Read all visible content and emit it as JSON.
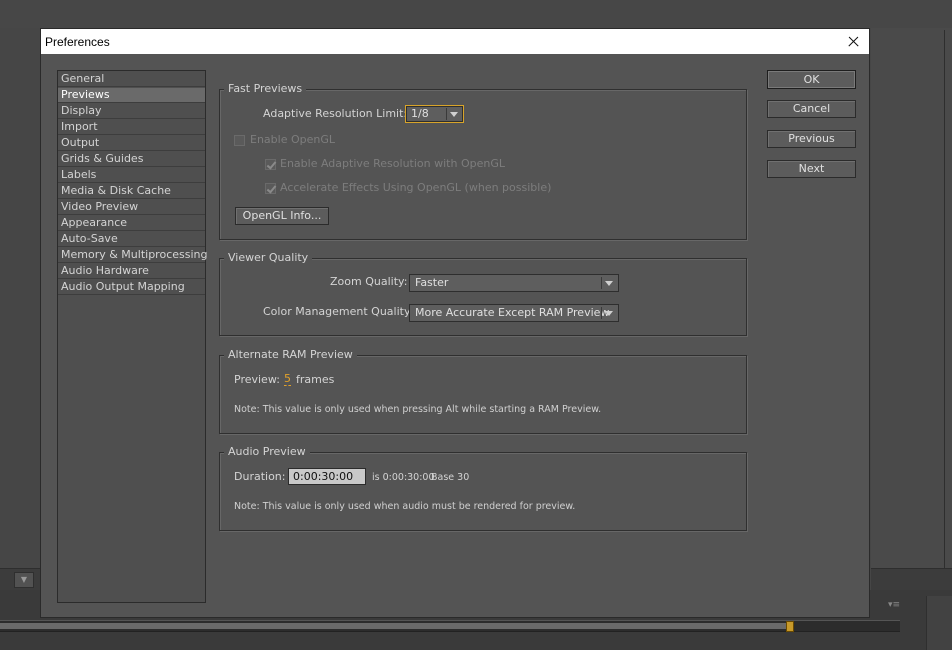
{
  "dialog": {
    "title": "Preferences"
  },
  "categories": [
    {
      "label": "General",
      "selected": false
    },
    {
      "label": "Previews",
      "selected": true
    },
    {
      "label": "Display",
      "selected": false
    },
    {
      "label": "Import",
      "selected": false
    },
    {
      "label": "Output",
      "selected": false
    },
    {
      "label": "Grids & Guides",
      "selected": false
    },
    {
      "label": "Labels",
      "selected": false
    },
    {
      "label": "Media & Disk Cache",
      "selected": false
    },
    {
      "label": "Video Preview",
      "selected": false
    },
    {
      "label": "Appearance",
      "selected": false
    },
    {
      "label": "Auto-Save",
      "selected": false
    },
    {
      "label": "Memory & Multiprocessing",
      "selected": false
    },
    {
      "label": "Audio Hardware",
      "selected": false
    },
    {
      "label": "Audio Output Mapping",
      "selected": false
    }
  ],
  "fast_previews": {
    "title": "Fast Previews",
    "adaptive_label": "Adaptive Resolution Limit:",
    "adaptive_value": "1/8",
    "enable_opengl_label": "Enable OpenGL",
    "enable_opengl_checked": false,
    "adaptive_opengl_label": "Enable Adaptive Resolution with OpenGL",
    "adaptive_opengl_checked": true,
    "accelerate_label": "Accelerate Effects Using OpenGL (when possible)",
    "accelerate_checked": true,
    "opengl_info_button": "OpenGL Info..."
  },
  "viewer_quality": {
    "title": "Viewer Quality",
    "zoom_label": "Zoom Quality:",
    "zoom_value": "Faster",
    "color_label": "Color Management Quality:",
    "color_value": "More Accurate Except RAM Preview"
  },
  "ram_preview": {
    "title": "Alternate RAM Preview",
    "preview_label": "Preview:",
    "preview_value": "5",
    "preview_unit": "frames",
    "note": "Note: This value is only used when pressing Alt while starting a RAM Preview."
  },
  "audio_preview": {
    "title": "Audio Preview",
    "duration_label": "Duration:",
    "duration_value": "0:00:30:00",
    "duration_info": "is 0:00:30:00",
    "base_info": "Base 30",
    "note": "Note: This value is only used when audio must be rendered for preview."
  },
  "buttons": {
    "ok": "OK",
    "cancel": "Cancel",
    "previous": "Previous",
    "next": "Next"
  },
  "colors": {
    "dialog_bg": "#545454",
    "focus_accent": "#d8a42a",
    "scrub_value": "#e1a12a",
    "selected_item": "#6a6a6a"
  }
}
